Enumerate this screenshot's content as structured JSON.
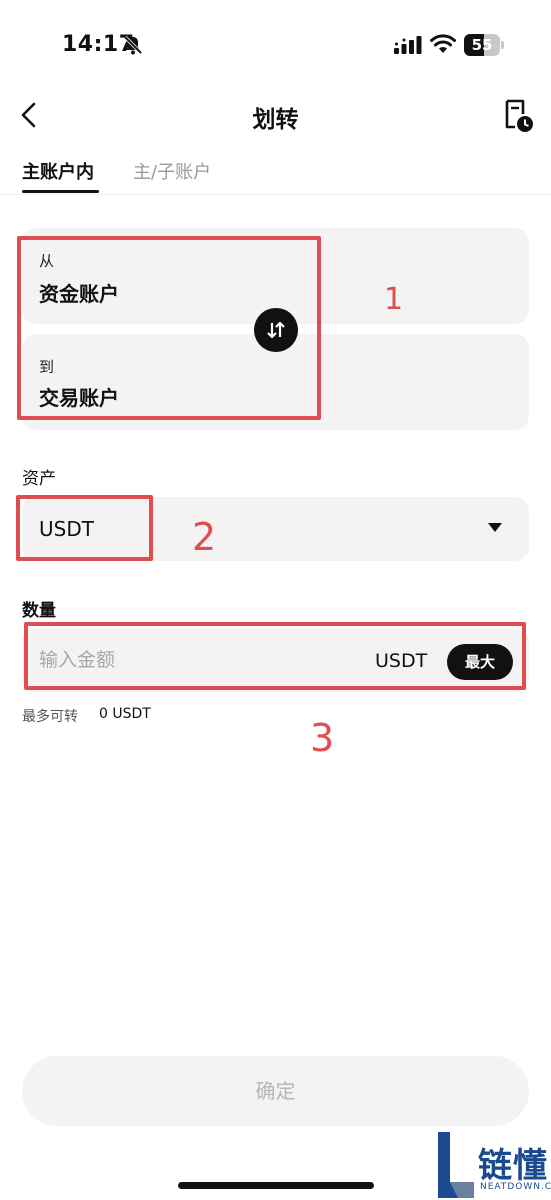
{
  "status_bar": {
    "time": "14:17",
    "battery": "55",
    "battery_level_percent": 55,
    "icons": [
      "bell-slash-icon",
      "signal-icon",
      "wifi-icon",
      "battery-icon"
    ]
  },
  "nav": {
    "title": "划转",
    "back_icon": "chevron-left-icon",
    "history_icon": "transfer-history-icon"
  },
  "tabs": [
    {
      "label": "主账户内",
      "active": true
    },
    {
      "label": "主/子账户",
      "active": false
    }
  ],
  "transfer": {
    "from_label": "从",
    "from_value": "资金账户",
    "to_label": "到",
    "to_value": "交易账户",
    "swap_icon": "swap-arrows-icon"
  },
  "asset": {
    "label": "资产",
    "value": "USDT",
    "caret_icon": "caret-down-icon"
  },
  "amount": {
    "label": "数量",
    "placeholder": "输入金额",
    "unit": "USDT",
    "max_label": "最大"
  },
  "max_transfer": {
    "label": "最多可转",
    "value": "0 USDT"
  },
  "annotations": [
    "1",
    "2",
    "3"
  ],
  "confirm_label": "确定",
  "watermark": {
    "text": "链懂",
    "sub": "NEATDOWN.COM"
  },
  "colors": {
    "annotation": "#e14d4f",
    "card_bg": "#f3f3f3",
    "primary": "#111111",
    "watermark": "#1a4a8f"
  }
}
